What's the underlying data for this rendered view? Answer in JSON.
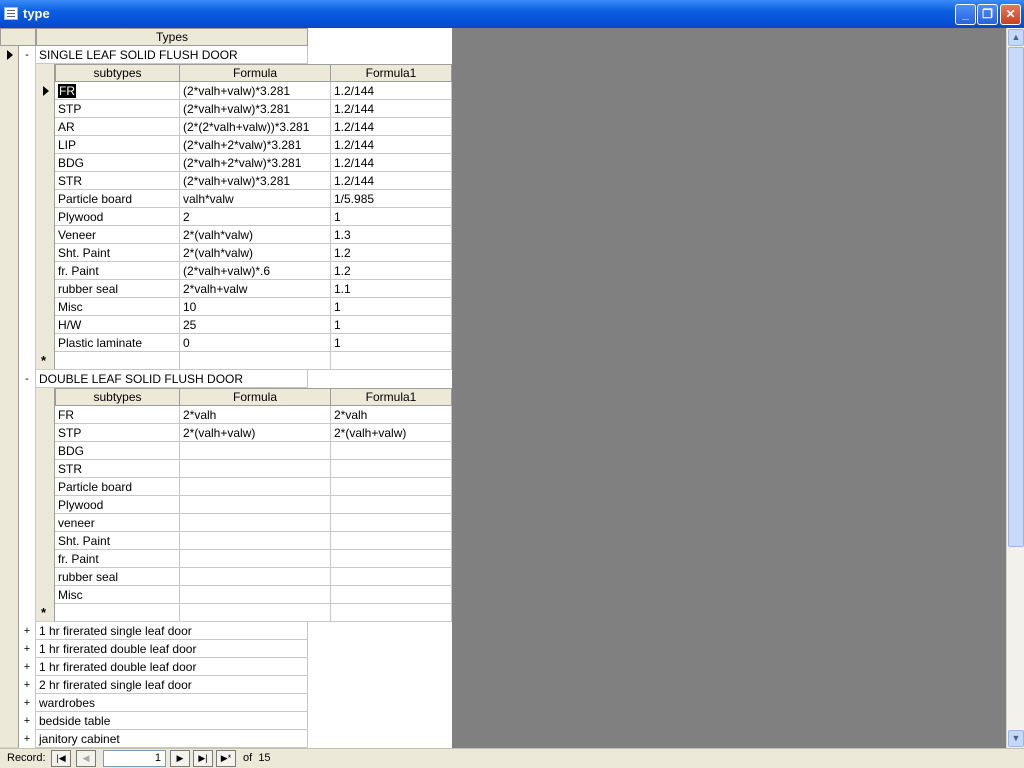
{
  "window": {
    "title": "type"
  },
  "main_grid": {
    "header": "Types"
  },
  "groups": [
    {
      "name": "SINGLE LEAF SOLID FLUSH DOOR",
      "expander": "-",
      "columns": [
        "subtypes",
        "Formula",
        "Formula1"
      ],
      "rows": [
        [
          "FR",
          "(2*valh+valw)*3.281",
          "1.2/144"
        ],
        [
          "STP",
          "(2*valh+valw)*3.281",
          "1.2/144"
        ],
        [
          "AR",
          "(2*(2*valh+valw))*3.281",
          "1.2/144"
        ],
        [
          "LIP",
          "(2*valh+2*valw)*3.281",
          "1.2/144"
        ],
        [
          "BDG",
          "(2*valh+2*valw)*3.281",
          "1.2/144"
        ],
        [
          "STR",
          "(2*valh+valw)*3.281",
          "1.2/144"
        ],
        [
          "Particle board",
          "valh*valw",
          "1/5.985"
        ],
        [
          "Plywood",
          "2",
          "1"
        ],
        [
          "Veneer",
          "2*(valh*valw)",
          "1.3"
        ],
        [
          "Sht. Paint",
          "2*(valh*valw)",
          "1.2"
        ],
        [
          "fr. Paint",
          "(2*valh+valw)*.6",
          "1.2"
        ],
        [
          "rubber seal",
          "2*valh+valw",
          "1.1"
        ],
        [
          "Misc",
          "10",
          "1"
        ],
        [
          "H/W",
          "25",
          "1"
        ],
        [
          "Plastic laminate",
          "0",
          "1"
        ]
      ]
    },
    {
      "name": "DOUBLE LEAF SOLID FLUSH DOOR",
      "expander": "-",
      "columns": [
        "subtypes",
        "Formula",
        "Formula1"
      ],
      "rows": [
        [
          "FR",
          "2*valh",
          "2*valh"
        ],
        [
          "STP",
          "2*(valh+valw)",
          "2*(valh+valw)"
        ],
        [
          "BDG",
          "",
          ""
        ],
        [
          "STR",
          "",
          ""
        ],
        [
          "Particle board",
          "",
          ""
        ],
        [
          "Plywood",
          "",
          ""
        ],
        [
          "veneer",
          "",
          ""
        ],
        [
          "Sht. Paint",
          "",
          ""
        ],
        [
          "fr. Paint",
          "",
          ""
        ],
        [
          "rubber seal",
          "",
          ""
        ],
        [
          "Misc",
          "",
          ""
        ]
      ]
    }
  ],
  "collapsed_rows": [
    {
      "expander": "+",
      "name": "1 hr firerated single leaf door"
    },
    {
      "expander": "+",
      "name": "1 hr firerated double leaf door"
    },
    {
      "expander": "+",
      "name": "1 hr firerated double leaf door"
    },
    {
      "expander": "+",
      "name": "2 hr firerated single leaf door"
    },
    {
      "expander": "+",
      "name": "wardrobes"
    },
    {
      "expander": "+",
      "name": "bedside table"
    },
    {
      "expander": "+",
      "name": "janitory cabinet"
    }
  ],
  "new_record_symbol": "*",
  "record_nav": {
    "label": "Record:",
    "current": "1",
    "of_text": "of",
    "total": "15"
  },
  "icons": {
    "first": "first-record-icon",
    "prev": "previous-record-icon",
    "next": "next-record-icon",
    "last": "last-record-icon",
    "new": "new-record-icon"
  }
}
